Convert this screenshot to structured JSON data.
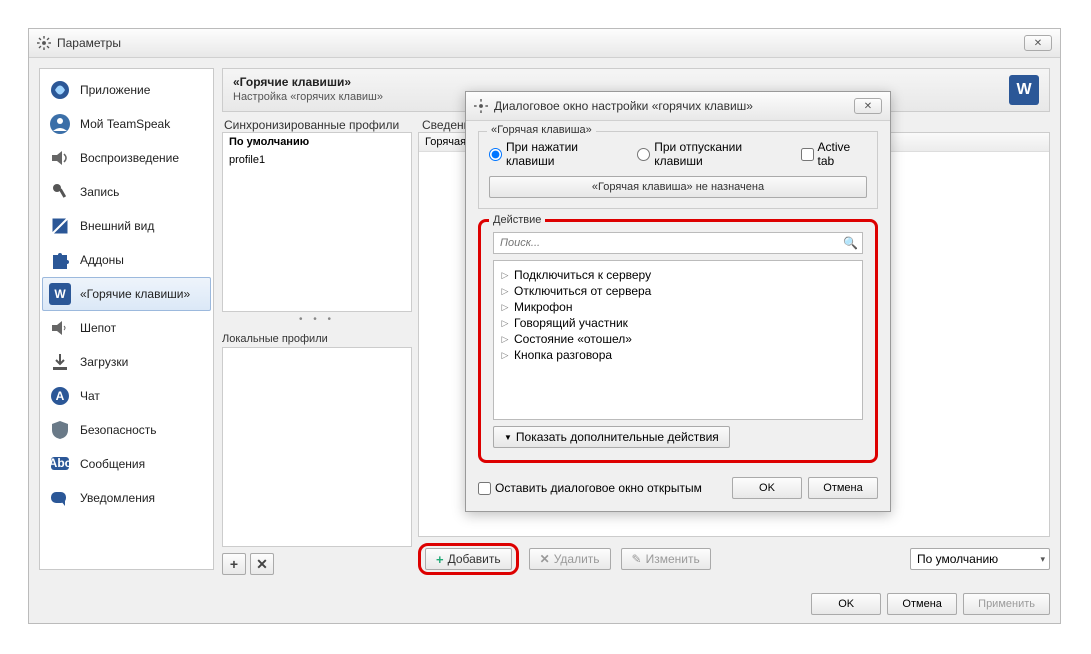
{
  "main": {
    "title": "Параметры",
    "header_title": "«Горячие клавиши»",
    "header_sub": "Настройка «горячих клавиш»",
    "sync_profiles_label": "Синхронизированные профили",
    "details_label": "Сведения",
    "details_col": "Горячая",
    "profiles": [
      {
        "name": "По умолчанию",
        "selected": true
      },
      {
        "name": "profile1",
        "selected": false
      }
    ],
    "local_profiles_label": "Локальные профили",
    "add_label": "Добавить",
    "delete_label": "Удалить",
    "edit_label": "Изменить",
    "dropdown_value": "По умолчанию",
    "ok": "OK",
    "cancel": "Отмена",
    "apply": "Применить"
  },
  "sidebar": {
    "items": [
      {
        "label": "Приложение"
      },
      {
        "label": "Мой TeamSpeak"
      },
      {
        "label": "Воспроизведение"
      },
      {
        "label": "Запись"
      },
      {
        "label": "Внешний вид"
      },
      {
        "label": "Аддоны"
      },
      {
        "label": "«Горячие клавиши»"
      },
      {
        "label": "Шепот"
      },
      {
        "label": "Загрузки"
      },
      {
        "label": "Чат"
      },
      {
        "label": "Безопасность"
      },
      {
        "label": "Сообщения"
      },
      {
        "label": "Уведомления"
      }
    ]
  },
  "dialog": {
    "title": "Диалоговое окно настройки «горячих клавиш»",
    "hotkey_legend": "«Горячая клавиша»",
    "on_press": "При нажатии клавиши",
    "on_release": "При отпускании клавиши",
    "active_tab": "Active tab",
    "unassigned_btn": "«Горячая клавиша» не назначена",
    "action_legend": "Действие",
    "search_placeholder": "Поиск...",
    "tree": [
      "Подключиться к серверу",
      "Отключиться от сервера",
      "Микрофон",
      "Говорящий участник",
      "Состояние «отошел»",
      "Кнопка разговора"
    ],
    "show_more": "Показать дополнительные действия",
    "keep_open": "Оставить диалоговое окно открытым",
    "ok": "OK",
    "cancel": "Отмена"
  }
}
